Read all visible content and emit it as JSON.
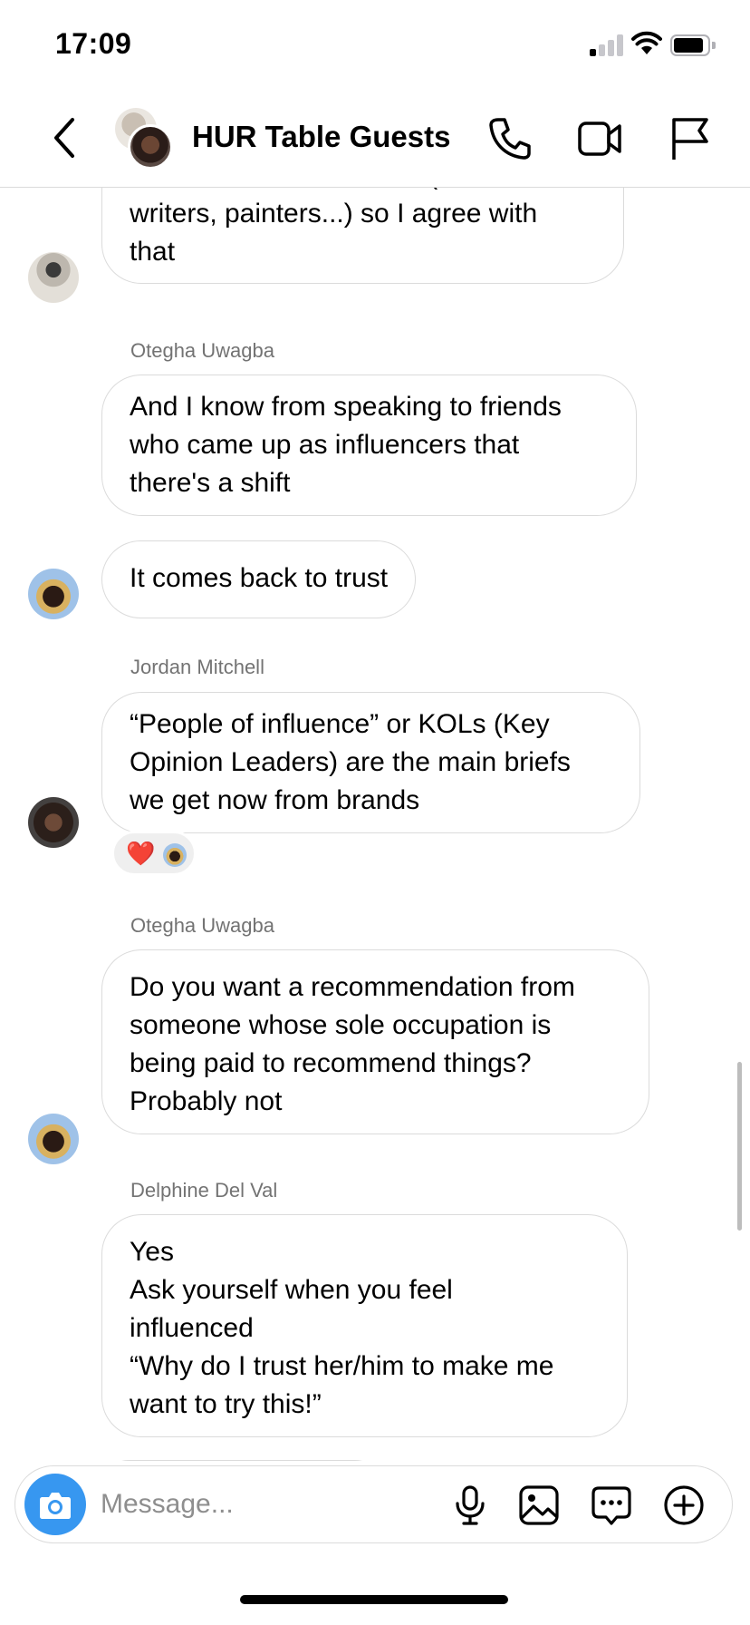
{
  "status_bar": {
    "time": "17:09",
    "signal_bars": 1,
    "battery_level": 0.8
  },
  "header": {
    "title": "HUR Table Guests",
    "icons": [
      "back-icon",
      "phone-icon",
      "video-camera-icon",
      "flag-icon"
    ]
  },
  "conversation": {
    "messages": [
      {
        "sender": "",
        "text": "real talent with influence (chef,\nwriters, painters...) so I agree with\nthat"
      },
      {
        "sender": "Otegha Uwagba",
        "text": "And I know from speaking to friends\nwho came up as influencers that\nthere's a shift"
      },
      {
        "sender": "",
        "text": "It comes back to trust"
      },
      {
        "sender": "Jordan Mitchell",
        "text": "“People of influence” or KOLs (Key\nOpinion Leaders) are the main briefs\nwe get now from brands",
        "reaction": "❤️"
      },
      {
        "sender": "Otegha Uwagba",
        "text": "Do you want a recommendation from\nsomeone whose sole occupation is\nbeing paid to recommend things?\nProbably not"
      },
      {
        "sender": "Delphine Del Val",
        "text": "Yes\nAsk yourself when you feel\ninfluenced\n“Why do I trust her/him to make me\nwant to try this!”"
      }
    ]
  },
  "composer": {
    "placeholder": "Message...",
    "icons": [
      "camera-icon",
      "microphone-icon",
      "image-icon",
      "sticker-icon",
      "add-icon"
    ],
    "accent": "#3797f0"
  }
}
